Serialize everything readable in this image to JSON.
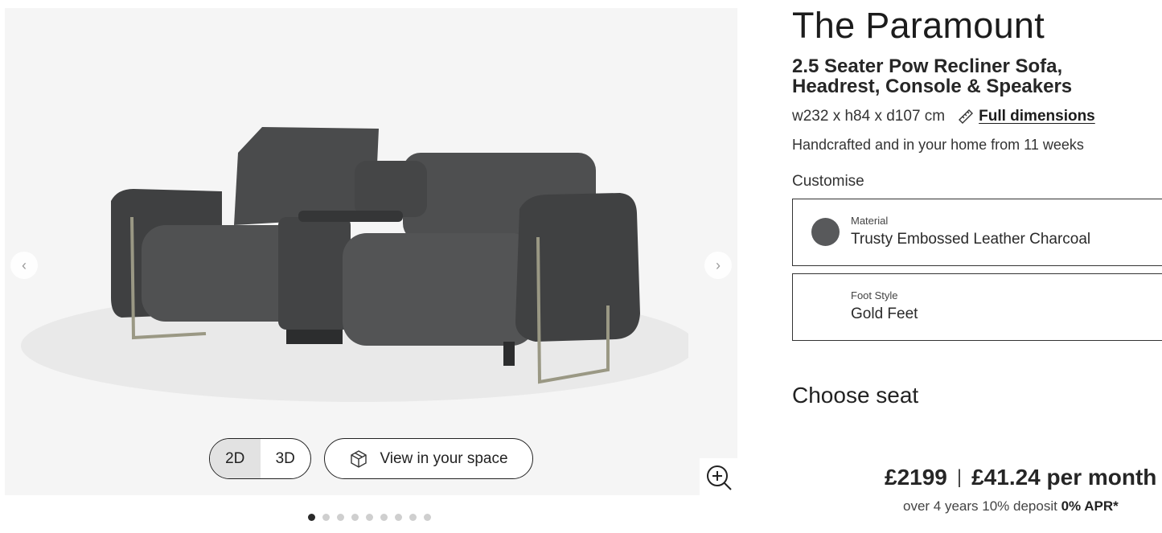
{
  "gallery": {
    "view_toggle": {
      "options": [
        "2D",
        "3D"
      ],
      "selected": "2D"
    },
    "ar_button_label": "View in your space",
    "icons": {
      "prev": "chevron-left-icon",
      "next": "chevron-right-icon",
      "ar": "cube-icon",
      "zoom": "zoom-in-icon"
    },
    "dots": {
      "count": 9,
      "active_index": 0
    }
  },
  "product": {
    "title": "The Paramount",
    "subtitle": "2.5 Seater Pow Recliner Sofa, Headrest, Console & Speakers",
    "dimensions": "w232 x h84 x d107 cm",
    "full_dimensions_label": "Full dimensions",
    "delivery": "Handcrafted and in your home from 11 weeks",
    "customise_label": "Customise",
    "options": {
      "material": {
        "label": "Material",
        "value": "Trusty Embossed Leather Charcoal",
        "swatch_color": "#58595b"
      },
      "foot": {
        "label": "Foot Style",
        "value": "Gold Feet"
      }
    },
    "choose_seat_label": "Choose seat",
    "price": "£2199",
    "price_separator": "|",
    "monthly": "£41.24 per month",
    "finance_prefix": "over 4 years 10% deposit",
    "finance_apr": "0% APR*"
  }
}
